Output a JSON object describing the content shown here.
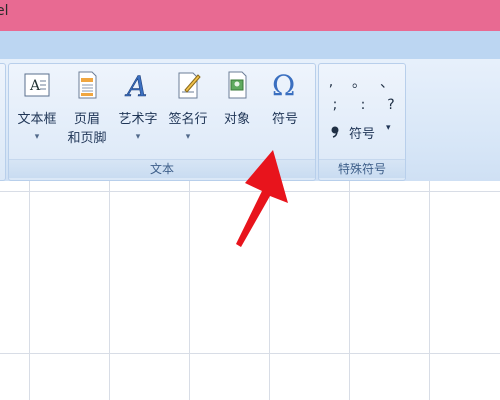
{
  "window": {
    "title_fragment": "el"
  },
  "ribbon": {
    "text_group": {
      "label": "文本",
      "buttons": [
        {
          "name": "textbox",
          "label": "文本框",
          "dropdown": true
        },
        {
          "name": "header-footer",
          "label_line1": "页眉",
          "label_line2": "和页脚"
        },
        {
          "name": "wordart",
          "label": "艺术字",
          "dropdown": true
        },
        {
          "name": "signature-line",
          "label": "签名行",
          "dropdown": true
        },
        {
          "name": "object",
          "label": "对象"
        },
        {
          "name": "symbol",
          "label": "符号"
        }
      ]
    },
    "special_symbols_group": {
      "label": "特殊符号",
      "symbols": [
        ",",
        "。",
        "、",
        ";",
        ":",
        "?"
      ],
      "symbol_button_label": "符号"
    }
  },
  "colors": {
    "title_bar": "#e86a92",
    "ribbon": "#dbe8f7",
    "arrow": "#e8141c"
  }
}
